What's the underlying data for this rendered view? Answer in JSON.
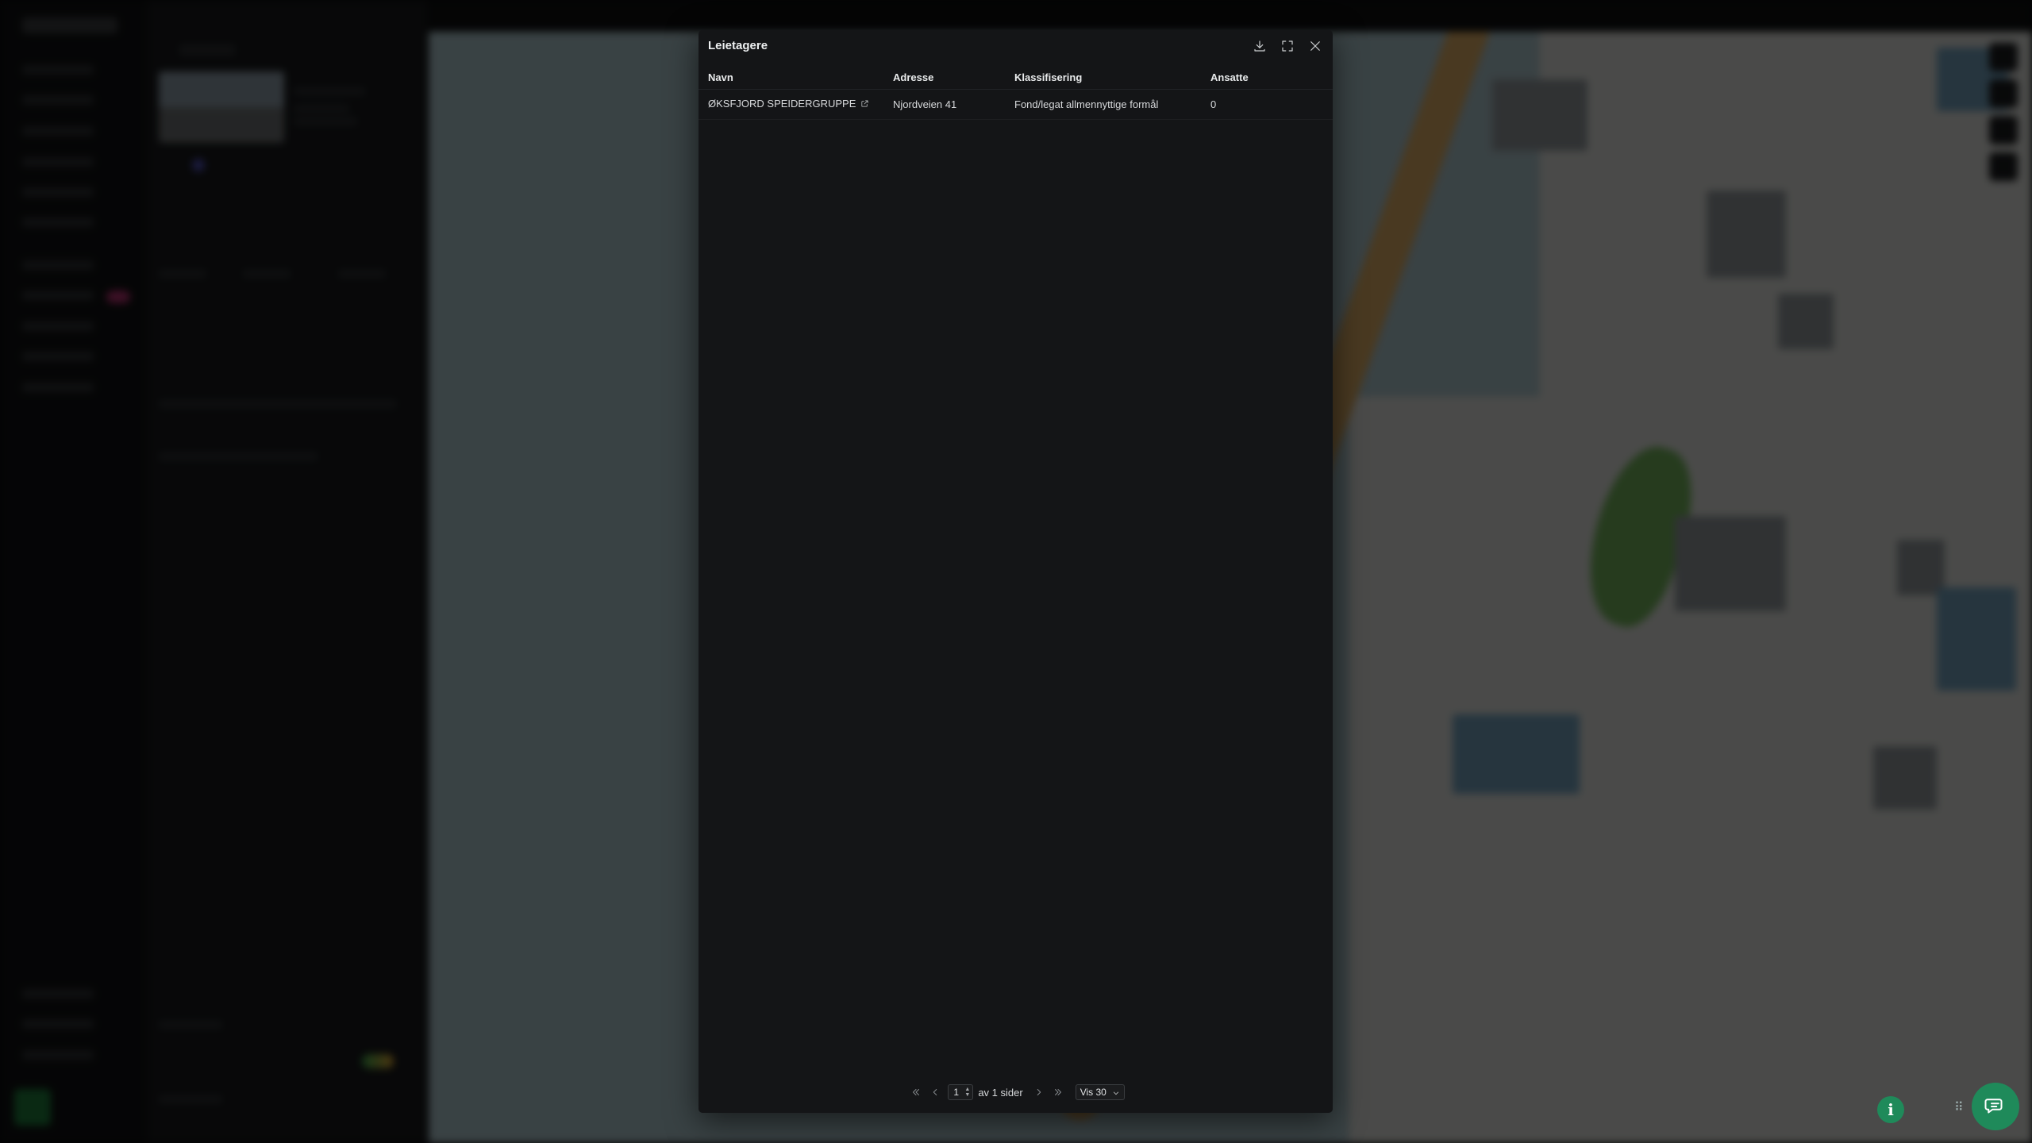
{
  "modal": {
    "title": "Leietagere",
    "actions": {
      "download_icon": "download-icon",
      "expand_icon": "expand-icon",
      "close_icon": "close-icon"
    }
  },
  "table": {
    "columns": [
      "Navn",
      "Adresse",
      "Klassifisering",
      "Ansatte"
    ],
    "rows": [
      {
        "navn": "ØKSFJORD SPEIDERGRUPPE",
        "adresse": "Njordveien 41",
        "klassifisering": "Fond/legat allmennyttige formål",
        "ansatte": "0"
      }
    ]
  },
  "pagination": {
    "current_page": "1",
    "of_label": "av 1 sider",
    "per_page": "Vis 30"
  },
  "colors": {
    "modal_bg": "#141517",
    "accent_green": "#1f8a5a",
    "road": "#d6a862"
  }
}
